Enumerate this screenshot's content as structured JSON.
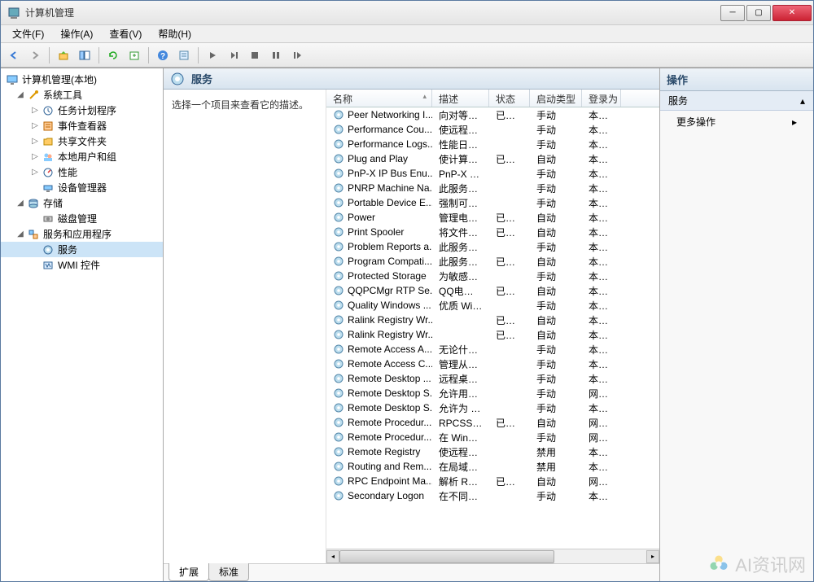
{
  "window": {
    "title": "计算机管理"
  },
  "menu": {
    "file": "文件(F)",
    "action": "操作(A)",
    "view": "查看(V)",
    "help": "帮助(H)"
  },
  "tree": {
    "root": "计算机管理(本地)",
    "systools": "系统工具",
    "tasksched": "任务计划程序",
    "eventvwr": "事件查看器",
    "sharedfolders": "共享文件夹",
    "localusers": "本地用户和组",
    "perf": "性能",
    "devmgr": "设备管理器",
    "storage": "存储",
    "diskmgmt": "磁盘管理",
    "svcapps": "服务和应用程序",
    "services": "服务",
    "wmi": "WMI 控件"
  },
  "center": {
    "header": "服务",
    "desc": "选择一个项目来查看它的描述。",
    "columns": {
      "name": "名称",
      "desc": "描述",
      "status": "状态",
      "start": "启动类型",
      "logon": "登录为"
    },
    "tabs": {
      "ext": "扩展",
      "std": "标准"
    }
  },
  "actions": {
    "title": "操作",
    "section": "服务",
    "more": "更多操作"
  },
  "services": [
    {
      "name": "Peer Networking I...",
      "desc": "向对等名...",
      "status": "已启动",
      "start": "手动",
      "logon": "本地服"
    },
    {
      "name": "Performance Cou...",
      "desc": "使远程用...",
      "status": "",
      "start": "手动",
      "logon": "本地服"
    },
    {
      "name": "Performance Logs...",
      "desc": "性能日志...",
      "status": "",
      "start": "手动",
      "logon": "本地服"
    },
    {
      "name": "Plug and Play",
      "desc": "使计算机...",
      "status": "已启动",
      "start": "自动",
      "logon": "本地系"
    },
    {
      "name": "PnP-X IP Bus Enu...",
      "desc": "PnP-X 总...",
      "status": "",
      "start": "手动",
      "logon": "本地系"
    },
    {
      "name": "PNRP Machine Na...",
      "desc": "此服务使...",
      "status": "",
      "start": "手动",
      "logon": "本地服"
    },
    {
      "name": "Portable Device E...",
      "desc": "强制可移...",
      "status": "",
      "start": "手动",
      "logon": "本地系"
    },
    {
      "name": "Power",
      "desc": "管理电源...",
      "status": "已启动",
      "start": "自动",
      "logon": "本地系"
    },
    {
      "name": "Print Spooler",
      "desc": "将文件加...",
      "status": "已启动",
      "start": "自动",
      "logon": "本地系"
    },
    {
      "name": "Problem Reports a...",
      "desc": "此服务为...",
      "status": "",
      "start": "手动",
      "logon": "本地系"
    },
    {
      "name": "Program Compati...",
      "desc": "此服务为...",
      "status": "已启动",
      "start": "自动",
      "logon": "本地系"
    },
    {
      "name": "Protected Storage",
      "desc": "为敏感数...",
      "status": "",
      "start": "手动",
      "logon": "本地系"
    },
    {
      "name": "QQPCMgr RTP Se...",
      "desc": "QQ电脑管...",
      "status": "已启动",
      "start": "自动",
      "logon": "本地系"
    },
    {
      "name": "Quality Windows ...",
      "desc": "优质 Wind...",
      "status": "",
      "start": "手动",
      "logon": "本地服"
    },
    {
      "name": "Ralink Registry Wr...",
      "desc": "",
      "status": "已启动",
      "start": "自动",
      "logon": "本地系"
    },
    {
      "name": "Ralink Registry Wr...",
      "desc": "",
      "status": "已启动",
      "start": "自动",
      "logon": "本地系"
    },
    {
      "name": "Remote Access A...",
      "desc": "无论什么...",
      "status": "",
      "start": "手动",
      "logon": "本地系"
    },
    {
      "name": "Remote Access C...",
      "desc": "管理从这...",
      "status": "",
      "start": "手动",
      "logon": "本地系"
    },
    {
      "name": "Remote Desktop ...",
      "desc": "远程桌面...",
      "status": "",
      "start": "手动",
      "logon": "本地系"
    },
    {
      "name": "Remote Desktop S...",
      "desc": "允许用户...",
      "status": "",
      "start": "手动",
      "logon": "网络服"
    },
    {
      "name": "Remote Desktop S...",
      "desc": "允许为 RD...",
      "status": "",
      "start": "手动",
      "logon": "本地系"
    },
    {
      "name": "Remote Procedur...",
      "desc": "RPCSS 服...",
      "status": "已启动",
      "start": "自动",
      "logon": "网络服"
    },
    {
      "name": "Remote Procedur...",
      "desc": "在 Windo...",
      "status": "",
      "start": "手动",
      "logon": "网络服"
    },
    {
      "name": "Remote Registry",
      "desc": "使远程用...",
      "status": "",
      "start": "禁用",
      "logon": "本地服"
    },
    {
      "name": "Routing and Rem...",
      "desc": "在局域网...",
      "status": "",
      "start": "禁用",
      "logon": "本地系"
    },
    {
      "name": "RPC Endpoint Ma...",
      "desc": "解析 RPC ...",
      "status": "已启动",
      "start": "自动",
      "logon": "网络服"
    },
    {
      "name": "Secondary Logon",
      "desc": "在不同凭...",
      "status": "",
      "start": "手动",
      "logon": "本地系"
    }
  ],
  "watermark": "AI资讯网"
}
